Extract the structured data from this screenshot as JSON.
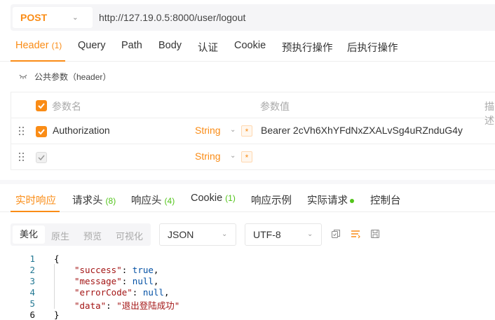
{
  "request": {
    "method": "POST",
    "url": "http://127.19.0.5:8000/user/logout"
  },
  "req_tabs": [
    {
      "label": "Header",
      "count": "(1)"
    },
    {
      "label": "Query"
    },
    {
      "label": "Path"
    },
    {
      "label": "Body"
    },
    {
      "label": "认证"
    },
    {
      "label": "Cookie"
    },
    {
      "label": "预执行操作"
    },
    {
      "label": "后执行操作"
    }
  ],
  "params_section": "公共参数（header）",
  "params_table": {
    "col_name": "参数名",
    "col_value": "参数值",
    "col_desc": "描述",
    "rows": [
      {
        "name": "Authorization",
        "type": "String",
        "required": "*",
        "value": "Bearer 2cVh6XhYFdNxZXALvSg4uRZnduG4y",
        "checked": true
      },
      {
        "name": "",
        "type": "String",
        "required": "*",
        "value": "",
        "checked": false
      }
    ]
  },
  "resp_tabs": [
    {
      "label": "实时响应"
    },
    {
      "label": "请求头",
      "count": "(8)"
    },
    {
      "label": "响应头",
      "count": "(4)"
    },
    {
      "label": "Cookie",
      "count": "(1)"
    },
    {
      "label": "响应示例"
    },
    {
      "label": "实际请求"
    },
    {
      "label": "控制台"
    }
  ],
  "format_modes": [
    "美化",
    "原生",
    "预览",
    "可视化"
  ],
  "format_select": "JSON",
  "encoding_select": "UTF-8",
  "code": {
    "line_numbers": [
      "1",
      "2",
      "3",
      "4",
      "5",
      "6"
    ],
    "open": "{",
    "close": "}",
    "fields": [
      {
        "key": "\"success\"",
        "value": "true",
        "sep": ","
      },
      {
        "key": "\"message\"",
        "value": "null",
        "sep": ","
      },
      {
        "key": "\"errorCode\"",
        "value": "null",
        "sep": ","
      },
      {
        "key": "\"data\"",
        "value": "\"退出登陆成功\"",
        "sep": ""
      }
    ]
  },
  "colors": {
    "accent": "#fa8c16",
    "count_green": "#52c41a"
  }
}
